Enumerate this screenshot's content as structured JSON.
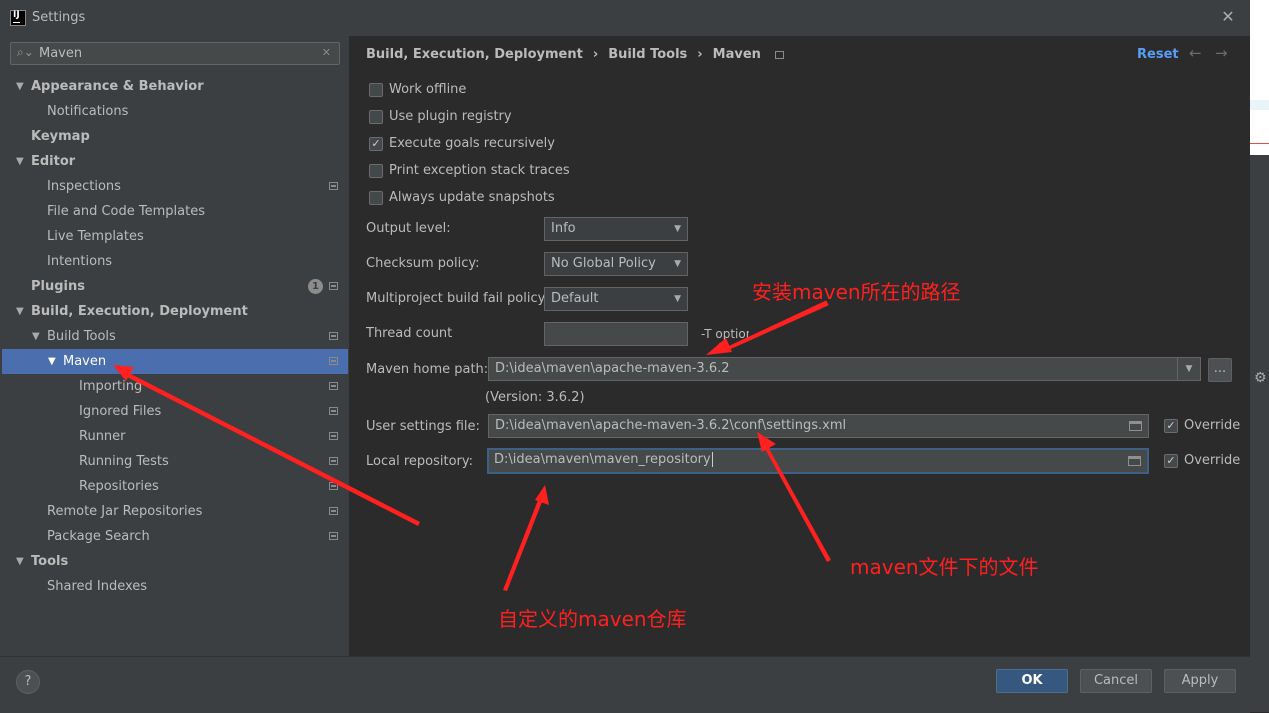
{
  "window": {
    "title": "Settings"
  },
  "search": {
    "value": "Maven",
    "placeholder": ""
  },
  "tree": {
    "appearance": "Appearance & Behavior",
    "notifications": "Notifications",
    "keymap": "Keymap",
    "editor": "Editor",
    "inspections": "Inspections",
    "file_templates": "File and Code Templates",
    "live_templates": "Live Templates",
    "intentions": "Intentions",
    "plugins": "Plugins",
    "plugins_badge": "1",
    "build": "Build, Execution, Deployment",
    "build_tools": "Build Tools",
    "maven": "Maven",
    "importing": "Importing",
    "ignored_files": "Ignored Files",
    "runner": "Runner",
    "running_tests": "Running Tests",
    "repositories": "Repositories",
    "remote_jar": "Remote Jar Repositories",
    "package_search": "Package Search",
    "tools": "Tools",
    "shared_indexes": "Shared Indexes"
  },
  "breadcrumb": {
    "p1": "Build, Execution, Deployment",
    "p2": "Build Tools",
    "p3": "Maven",
    "sep": "›"
  },
  "reset_label": "Reset",
  "options": {
    "work_offline": "Work offline",
    "plugin_registry": "Use plugin registry",
    "execute_goals": "Execute goals recursively",
    "print_exception": "Print exception stack traces",
    "always_update": "Always update snapshots"
  },
  "fields": {
    "output_level_label": "Output level:",
    "output_level_value": "Info",
    "checksum_label": "Checksum policy:",
    "checksum_value": "No Global Policy",
    "multiproject_label": "Multiproject build fail policy:",
    "multiproject_value": "Default",
    "thread_label": "Thread count",
    "thread_value": "",
    "thread_hint": "-T option",
    "home_label": "Maven home path:",
    "home_value": "D:\\idea\\maven\\apache-maven-3.6.2",
    "version": "(Version: 3.6.2)",
    "user_settings_label": "User settings file:",
    "user_settings_value": "D:\\idea\\maven\\apache-maven-3.6.2\\conf\\settings.xml",
    "override_label": "Override",
    "local_repo_label": "Local repository:",
    "local_repo_value": "D:\\idea\\maven\\maven_repository",
    "browse": "..."
  },
  "annotations": {
    "install_path": "安装maven所在的路径",
    "maven_file": "maven文件下的文件",
    "custom_repo": "自定义的maven仓库"
  },
  "footer": {
    "help": "?",
    "ok": "OK",
    "cancel": "Cancel",
    "apply": "Apply"
  },
  "colors": {
    "selection": "#4b6eaf",
    "link": "#589df6",
    "annotation": "#ff2020",
    "primary_button": "#365880"
  }
}
